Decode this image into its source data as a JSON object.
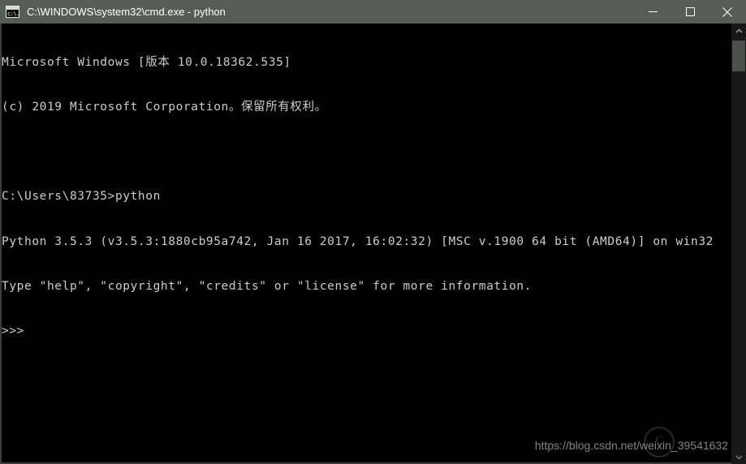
{
  "window": {
    "title": "C:\\WINDOWS\\system32\\cmd.exe - python",
    "icon": "cmd-icon",
    "icon_glyph": "c:\\.",
    "titlebar_color": "#555e55",
    "background_color": "#000000",
    "text_color": "#cccccc",
    "controls": {
      "minimize_label": "–",
      "maximize_label": "□",
      "close_label": "×"
    }
  },
  "terminal": {
    "lines": [
      "Microsoft Windows [版本 10.0.18362.535]",
      "(c) 2019 Microsoft Corporation。保留所有权利。",
      "",
      "C:\\Users\\83735>python",
      "Python 3.5.3 (v3.5.3:1880cb95a742, Jan 16 2017, 16:02:32) [MSC v.1900 64 bit (AMD64)] on win32",
      "Type \"help\", \"copyright\", \"credits\" or \"license\" for more information.",
      ">>>"
    ],
    "prompt": ">>>"
  },
  "scrollbar": {
    "up_arrow": "scroll-up-icon",
    "down_arrow": "scroll-down-icon",
    "thumb": "scroll-thumb"
  },
  "watermark": {
    "url": "https://blog.csdn.net/weixin_39541632",
    "logo_text": "C"
  }
}
